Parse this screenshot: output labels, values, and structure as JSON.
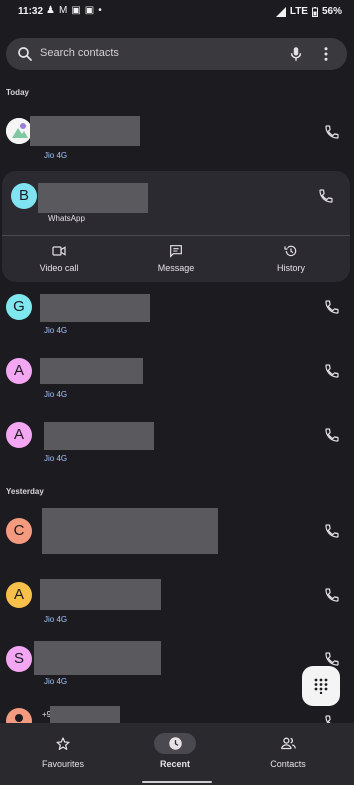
{
  "status_bar": {
    "time": "11:32",
    "network": "LTE",
    "battery": "56%"
  },
  "search": {
    "placeholder": "Search contacts"
  },
  "sections": {
    "today": "Today",
    "yesterday": "Yesterday"
  },
  "contacts": [
    {
      "initial": "",
      "subtitle": "Jio 4G",
      "avatar_color": "#ffffff",
      "avatar_type": "photo"
    },
    {
      "initial": "B",
      "subtitle": "WhatsApp",
      "avatar_color": "#7fe3f1",
      "expanded": true
    },
    {
      "initial": "G",
      "subtitle": "Jio 4G",
      "avatar_color": "#7fe8ee"
    },
    {
      "initial": "A",
      "subtitle": "Jio 4G",
      "avatar_color": "#f3a6f2"
    },
    {
      "initial": "A",
      "subtitle": "Jio 4G",
      "avatar_color": "#f3a6f2"
    },
    {
      "initial": "C",
      "subtitle": "",
      "avatar_color": "#f49a7e"
    },
    {
      "initial": "A",
      "subtitle": "Jio 4G",
      "avatar_color": "#f7c04a"
    },
    {
      "initial": "S",
      "subtitle": "Jio 4G",
      "avatar_color": "#f3a6f2"
    },
    {
      "initial": "",
      "subtitle": "",
      "avatar_color": "#f49a7e",
      "avatar_type": "person",
      "partial_text": "+9"
    }
  ],
  "expanded_actions": [
    {
      "label": "Video call",
      "icon": "video-call-icon"
    },
    {
      "label": "Message",
      "icon": "message-icon"
    },
    {
      "label": "History",
      "icon": "history-icon"
    }
  ],
  "bottom_nav": [
    {
      "label": "Favourites",
      "icon": "star-icon",
      "active": false
    },
    {
      "label": "Recent",
      "icon": "clock-icon",
      "active": true
    },
    {
      "label": "Contacts",
      "icon": "people-icon",
      "active": false
    }
  ],
  "colors": {
    "background": "#1c1b1f",
    "accent_link": "#9ec5ff",
    "search_bg": "#3a393e"
  }
}
